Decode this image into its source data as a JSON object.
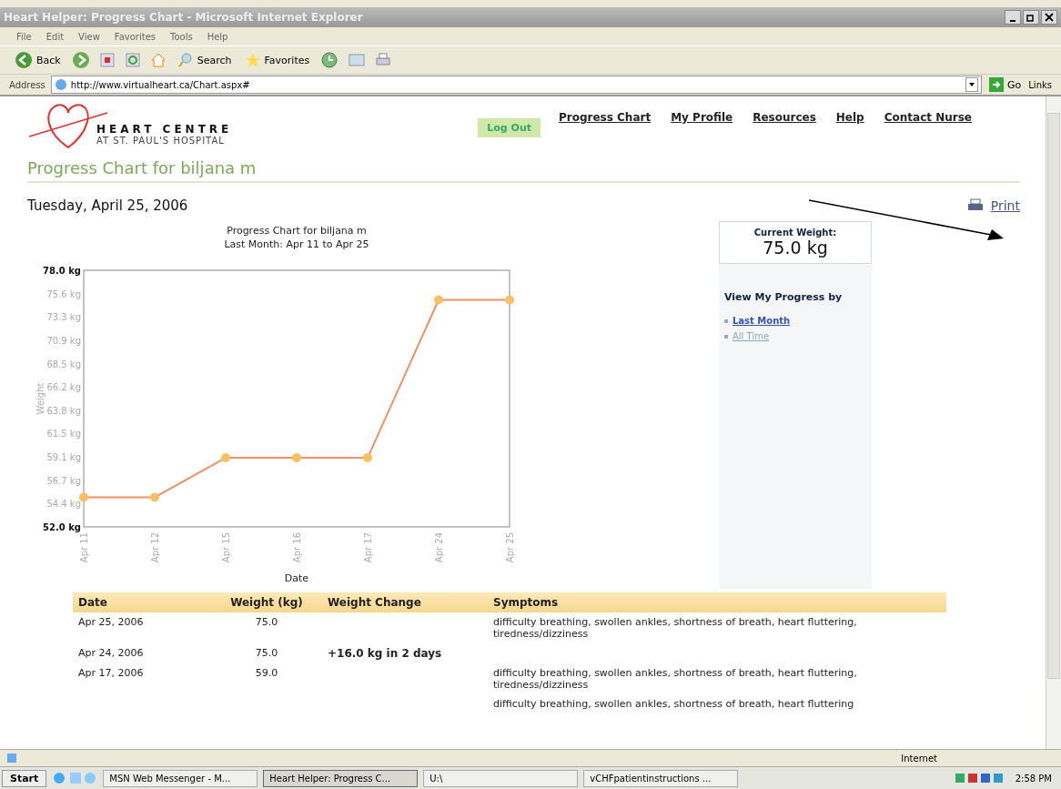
{
  "window": {
    "title": "Heart Helper: Progress Chart - Microsoft Internet Explorer"
  },
  "menu": [
    "File",
    "Edit",
    "View",
    "Favorites",
    "Tools",
    "Help"
  ],
  "toolbar": {
    "back": "Back",
    "search": "Search",
    "favorites": "Favorites"
  },
  "address": {
    "label": "Address",
    "value": "http://www.virtualheart.ca/Chart.aspx#",
    "go": "Go",
    "links": "Links"
  },
  "logo": {
    "title": "HEART CENTRE",
    "subtitle": "AT ST. PAUL'S HOSPITAL"
  },
  "logout": "Log Out",
  "nav": [
    "Progress Chart",
    "My Profile",
    "Resources",
    "Help",
    "Contact Nurse"
  ],
  "page_title": "Progress Chart for biljana m",
  "date": "Tuesday, April 25, 2006",
  "print": "Print",
  "chart": {
    "chart_data": {
      "type": "line",
      "title": "Progress Chart for biljana m\nLast Month: Apr 11 to Apr 25",
      "xlabel": "Date",
      "ylabel": "Weight",
      "categories": [
        "Apr 11",
        "Apr 12",
        "Apr 15",
        "Apr 16",
        "Apr 17",
        "Apr 24",
        "Apr 25"
      ],
      "series": [
        {
          "color": "#f0906a",
          "marker": "circle",
          "values": [
            55,
            55,
            59,
            59,
            59,
            75,
            75
          ]
        }
      ],
      "ylim": [
        52,
        78
      ],
      "yticks": [
        {
          "value": 78,
          "label": "78.0 kg"
        },
        {
          "value": 75.6,
          "label": "75.6 kg"
        },
        {
          "value": 73.3,
          "label": "73.3 kg"
        },
        {
          "value": 70.9,
          "label": "70.9 kg"
        },
        {
          "value": 68.5,
          "label": "68.5 kg"
        },
        {
          "value": 66.2,
          "label": "66.2 kg"
        },
        {
          "value": 63.8,
          "label": "63.8 kg"
        },
        {
          "value": 61.5,
          "label": "61.5 kg"
        },
        {
          "value": 59.1,
          "label": "59.1 kg"
        },
        {
          "value": 56.7,
          "label": "56.7 kg"
        },
        {
          "value": 54.4,
          "label": "54.4 kg"
        },
        {
          "value": 52,
          "label": "52.0 kg"
        }
      ]
    }
  },
  "current_weight": {
    "label": "Current Weight:",
    "value": "75.0 kg"
  },
  "view_by": {
    "heading": "View My Progress by",
    "options": [
      {
        "label": "Last Month",
        "selected": true
      },
      {
        "label": "All Time",
        "selected": false
      }
    ]
  },
  "table": {
    "columns": [
      "Date",
      "Weight (kg)",
      "Weight Change",
      "Symptoms"
    ],
    "rows": [
      {
        "date": "Apr 25, 2006",
        "weight": "75.0",
        "change": "",
        "symptoms": "difficulty breathing, swollen ankles, shortness of breath, heart fluttering, tiredness/dizziness"
      },
      {
        "date": "Apr 24, 2006",
        "weight": "75.0",
        "change": "+16.0 kg in 2 days",
        "symptoms": ""
      },
      {
        "date": "Apr 17, 2006",
        "weight": "59.0",
        "change": "",
        "symptoms": "difficulty breathing, swollen ankles, shortness of breath, heart fluttering, tiredness/dizziness"
      },
      {
        "date": "",
        "weight": "",
        "change": "",
        "symptoms": "difficulty breathing, swollen ankles, shortness of breath, heart fluttering"
      }
    ]
  },
  "status_bar": {
    "zone": "Internet"
  },
  "taskbar": {
    "start": "Start",
    "tasks": [
      {
        "label": "MSN Web Messenger - M...",
        "selected": false
      },
      {
        "label": "Heart Helper: Progress C...",
        "selected": true
      },
      {
        "label": "U:\\",
        "selected": false
      },
      {
        "label": "vCHFpatientinstructions ...",
        "selected": false
      }
    ],
    "clock": "2:58 PM"
  }
}
